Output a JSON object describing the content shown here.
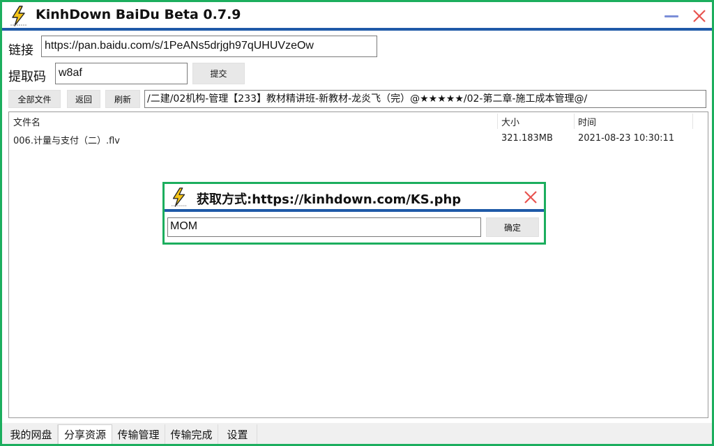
{
  "window": {
    "title": "KinhDown BaiDu Beta 0.7.9"
  },
  "form": {
    "link_label": "链接",
    "link_value": "https://pan.baidu.com/s/1PeANs5drjgh97qUHUVzeOw",
    "code_label": "提取码",
    "code_value": "w8af",
    "submit_label": "提交"
  },
  "toolbar": {
    "all_files_label": "全部文件",
    "back_label": "返回",
    "refresh_label": "刷新",
    "path": "/二建/02机构-管理【233】教材精讲班-新教材-龙炎飞（完）@★★★★★/02-第二章-施工成本管理@/"
  },
  "file_list": {
    "columns": [
      "文件名",
      "大小",
      "时间"
    ],
    "rows": [
      {
        "name": "006.计量与支付（二）.flv",
        "size": "321.183MB",
        "time": "2021-08-23 10:30:11"
      }
    ]
  },
  "dialog": {
    "title": "获取方式:https://kinhdown.com/KS.php",
    "input_value": "MOM",
    "confirm_label": "确定"
  },
  "tabs": [
    {
      "label": "我的网盘"
    },
    {
      "label": "分享资源",
      "active": true
    },
    {
      "label": "传输管理"
    },
    {
      "label": "传输完成"
    },
    {
      "label": "设置"
    }
  ],
  "colors": {
    "border_green": "#1cae5e",
    "rule_blue": "#1f5aa8",
    "close_red": "#e8534f",
    "minimize_blue": "#7b8ed8",
    "logo_yellow": "#f5c518"
  }
}
